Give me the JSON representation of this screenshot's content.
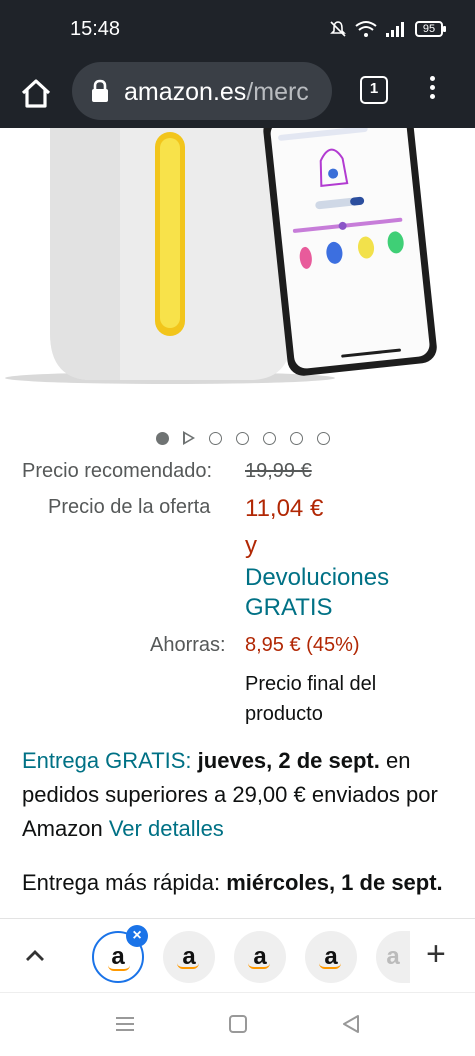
{
  "status_bar": {
    "time": "15:48",
    "battery": "95"
  },
  "toolbar": {
    "url_domain": "amazon.es",
    "url_path": "/merc",
    "tab_count": "1"
  },
  "carousel": {
    "dot_count": 7,
    "active_index": 0,
    "video_index": 1
  },
  "price": {
    "list_label": "Precio recomendado:",
    "list_value": "19,99 €",
    "deal_label": "Precio de la oferta",
    "deal_value": "11,04 €",
    "deal_and": "y",
    "returns": "Devoluciones GRATIS",
    "savings_label": "Ahorras:",
    "savings_value": "8,95 € (45%)",
    "final_note": "Precio final del producto"
  },
  "delivery": {
    "free_label": "Entrega GRATIS:",
    "date": "jueves, 2 de sept.",
    "condition": "en pedidos superiores a 29,00 € enviados por Amazon",
    "details_link": "Ver detalles",
    "fast_label": "Entrega más rápida:",
    "fast_date": "miércoles, 1 de sept."
  },
  "tab_strip": {
    "tabs": [
      "a",
      "a",
      "a",
      "a",
      "a"
    ],
    "close_glyph": "×",
    "add_glyph": "+"
  },
  "colors": {
    "accent": "#1a73e8",
    "price_red": "#b12704",
    "link_teal": "#007185",
    "dark_bar": "#1f2329"
  }
}
